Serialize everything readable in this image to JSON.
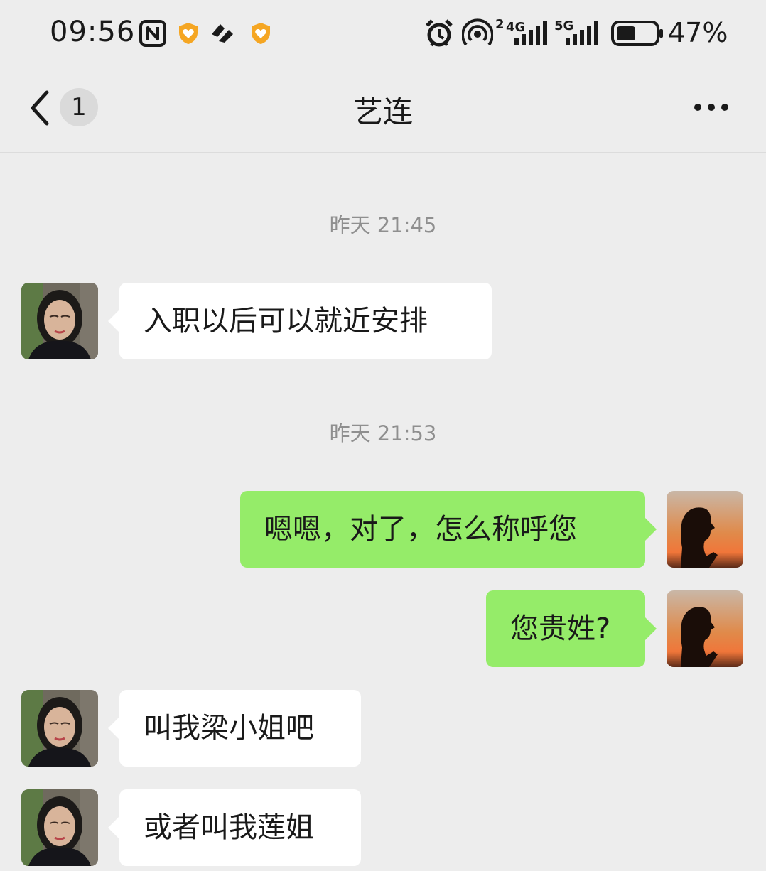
{
  "status_bar": {
    "time": "09:56",
    "network_1": "4G",
    "network_1_sim": "2",
    "network_2": "5G",
    "battery": "47%",
    "icons": [
      "nfc-icon",
      "heart-badge-icon",
      "app-icon",
      "heart-badge-icon",
      "alarm-icon",
      "hotspot-icon",
      "signal-icon",
      "signal-icon",
      "battery-icon"
    ]
  },
  "header": {
    "unread_count": "1",
    "title": "艺连"
  },
  "messages": [
    {
      "type": "timestamp",
      "text": "昨天 21:45"
    },
    {
      "type": "incoming",
      "text": "入职以后可以就近安排"
    },
    {
      "type": "timestamp",
      "text": "昨天 21:53"
    },
    {
      "type": "outgoing",
      "text": "嗯嗯，对了，怎么称呼您"
    },
    {
      "type": "outgoing",
      "text": "您贵姓?"
    },
    {
      "type": "incoming",
      "text": "叫我梁小姐吧"
    },
    {
      "type": "incoming",
      "text": "或者叫我莲姐"
    }
  ],
  "colors": {
    "background": "#ededed",
    "outgoing_bubble": "#95ec69",
    "incoming_bubble": "#ffffff",
    "timestamp_text": "#8f8f8f",
    "badge_orange": "#f5a623"
  }
}
